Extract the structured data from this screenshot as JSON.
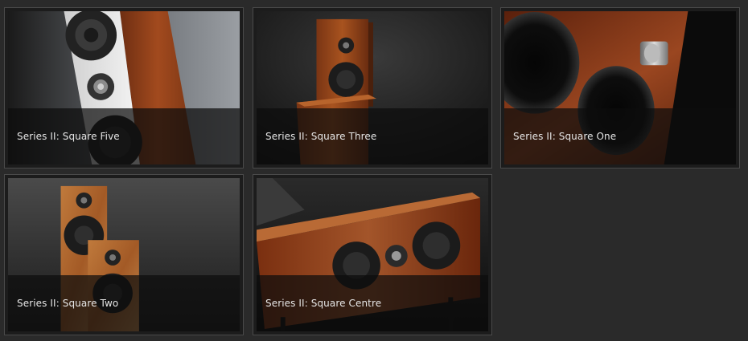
{
  "products": [
    {
      "title": "Series II: Square Five"
    },
    {
      "title": "Series II: Square Three"
    },
    {
      "title": "Series II: Square One"
    },
    {
      "title": "Series II: Square Two"
    },
    {
      "title": "Series II: Square Centre"
    }
  ],
  "colors": {
    "page_background": "#2a2a2a",
    "tile_border": "#4a4a4a",
    "caption_text": "#e6e6e6",
    "wood_walnut": "#8a3f1c",
    "wood_burl": "#a3552a",
    "wood_light": "#c98a4c"
  }
}
